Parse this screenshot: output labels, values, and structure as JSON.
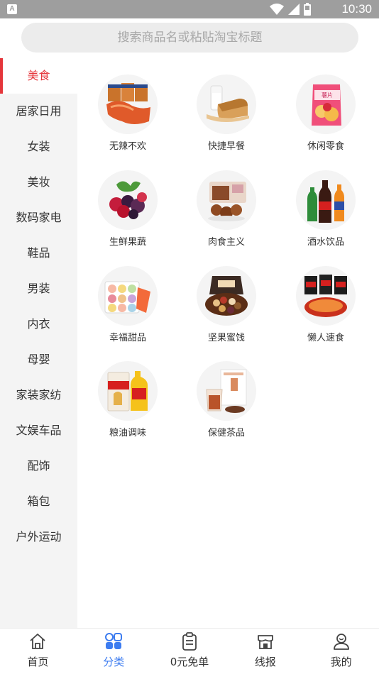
{
  "status_bar": {
    "time": "10:30",
    "notification_icon": "A"
  },
  "search": {
    "placeholder": "搜索商品名或粘贴淘宝标题"
  },
  "sidebar": {
    "items": [
      {
        "label": "美食",
        "active": true
      },
      {
        "label": "居家日用"
      },
      {
        "label": "女装"
      },
      {
        "label": "美妆"
      },
      {
        "label": "数码家电"
      },
      {
        "label": "鞋品"
      },
      {
        "label": "男装"
      },
      {
        "label": "内衣"
      },
      {
        "label": "母婴"
      },
      {
        "label": "家装家纺"
      },
      {
        "label": "文娱车品"
      },
      {
        "label": "配饰"
      },
      {
        "label": "箱包"
      },
      {
        "label": "户外运动"
      }
    ],
    "active_color": "#e5363b"
  },
  "categories": [
    {
      "label": "无辣不欢",
      "icon": "spicy-jerky-image"
    },
    {
      "label": "快捷早餐",
      "icon": "bread-milk-image"
    },
    {
      "label": "休闲零食",
      "icon": "chips-bag-image"
    },
    {
      "label": "生鲜果蔬",
      "icon": "berries-image"
    },
    {
      "label": "肉食主义",
      "icon": "meat-snack-image"
    },
    {
      "label": "酒水饮品",
      "icon": "soda-bottles-image"
    },
    {
      "label": "幸福甜品",
      "icon": "macarons-image"
    },
    {
      "label": "坚果蜜饯",
      "icon": "nuts-box-image"
    },
    {
      "label": "懒人速食",
      "icon": "instant-noodles-image"
    },
    {
      "label": "粮油调味",
      "icon": "rice-oil-image"
    },
    {
      "label": "保健茶品",
      "icon": "health-tea-image"
    }
  ],
  "bottom_nav": {
    "items": [
      {
        "label": "首页",
        "icon": "home-icon"
      },
      {
        "label": "分类",
        "icon": "category-icon",
        "active": true
      },
      {
        "label": "0元免单",
        "icon": "clipboard-icon"
      },
      {
        "label": "线报",
        "icon": "store-icon"
      },
      {
        "label": "我的",
        "icon": "profile-icon"
      }
    ],
    "active_color": "#3d7cf0"
  }
}
